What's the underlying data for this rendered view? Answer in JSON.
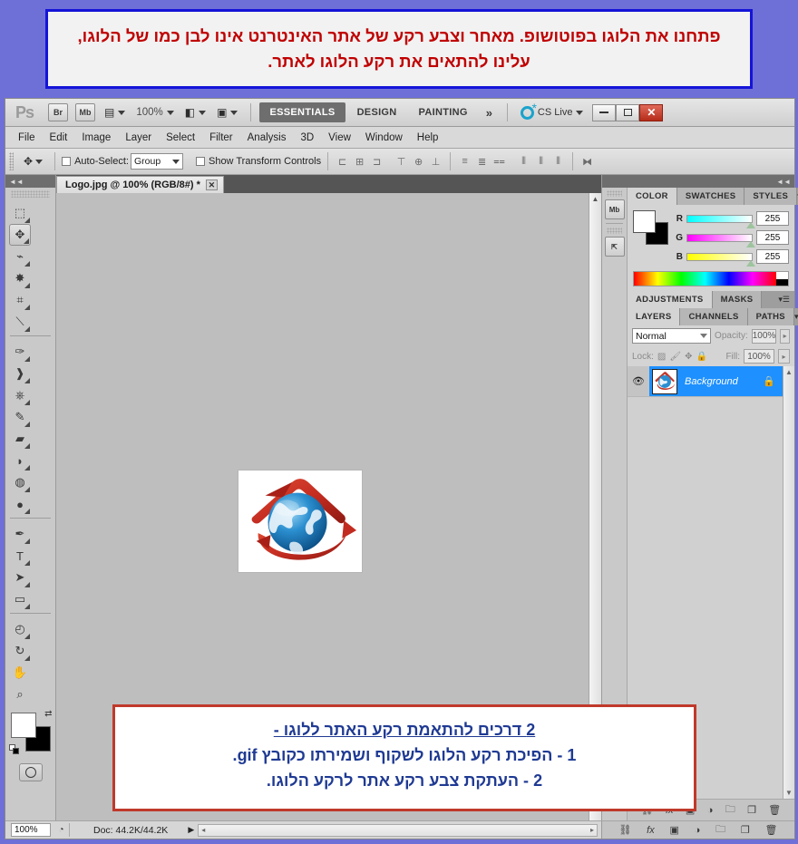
{
  "top_banner": {
    "text": "פתחנו את הלוגו בפוטושופ. מאחר וצבע רקע של אתר האינטרנט אינו לבן כמו של הלוגו, עלינו להתאים את רקע הלוגו לאתר.",
    "border_color": "#1414d8",
    "text_color": "#c00000"
  },
  "app": {
    "logo": "Ps",
    "bridge_button": "Br",
    "minibridge_button": "Mb",
    "view_extras_icon": "view-extras-icon",
    "zoom_level": "100%",
    "screen_mode_icon": "screen-mode-icon",
    "arrange_icon": "arrange-documents-icon",
    "workspaces": [
      {
        "label": "ESSENTIALS",
        "active": true
      },
      {
        "label": "DESIGN",
        "active": false
      },
      {
        "label": "PAINTING",
        "active": false
      }
    ],
    "more_workspaces": "»",
    "cs_live": "CS Live",
    "window_controls": {
      "minimize": "minimize-icon",
      "maximize": "maximize-icon",
      "close": "✕"
    }
  },
  "menu": {
    "items": [
      "File",
      "Edit",
      "Image",
      "Layer",
      "Select",
      "Filter",
      "Analysis",
      "3D",
      "View",
      "Window",
      "Help"
    ]
  },
  "options_bar": {
    "tool_icon": "move-tool-icon",
    "auto_select_label": "Auto-Select:",
    "auto_select_checked": false,
    "auto_select_value": "Group",
    "show_transform_label": "Show Transform Controls",
    "show_transform_checked": false,
    "align_left_edges": "align-left-edges-icon",
    "align_horizontal_centers": "align-horizontal-centers-icon",
    "align_right_edges": "align-right-edges-icon",
    "align_top_edges": "align-top-edges-icon",
    "align_vertical_centers": "align-vertical-centers-icon",
    "align_bottom_edges": "align-bottom-edges-icon",
    "distribute_top": "distribute-top-edges-icon",
    "distribute_vcenter": "distribute-vertical-centers-icon",
    "distribute_bottom": "distribute-bottom-edges-icon",
    "distribute_left": "distribute-left-edges-icon",
    "distribute_hcenter": "distribute-horizontal-centers-icon",
    "distribute_right": "distribute-right-edges-icon",
    "auto_align_layers": "auto-align-layers-icon"
  },
  "toolbox": {
    "collapse": "◄◄",
    "tools": [
      {
        "name": "rectangular-marquee-tool",
        "glyph": "⬚",
        "selected": false
      },
      {
        "name": "move-tool",
        "glyph": "✥",
        "selected": true
      },
      {
        "name": "lasso-tool",
        "glyph": "🪢",
        "selected": false
      },
      {
        "name": "quick-selection-tool",
        "glyph": "✷",
        "selected": false
      },
      {
        "name": "crop-tool",
        "glyph": "⌗",
        "selected": false
      },
      {
        "name": "eyedropper-tool",
        "glyph": "⟋",
        "selected": false
      },
      {
        "name": "spot-healing-brush-tool",
        "glyph": "✎",
        "selected": false
      },
      {
        "name": "brush-tool",
        "glyph": "🖌",
        "selected": false
      },
      {
        "name": "clone-stamp-tool",
        "glyph": "⎙",
        "selected": false
      },
      {
        "name": "history-brush-tool",
        "glyph": "✐",
        "selected": false
      },
      {
        "name": "eraser-tool",
        "glyph": "▰",
        "selected": false
      },
      {
        "name": "paint-bucket-tool",
        "glyph": "🪣",
        "selected": false
      },
      {
        "name": "blur-tool",
        "glyph": "💧",
        "selected": false
      },
      {
        "name": "dodge-tool",
        "glyph": "🔍",
        "selected": false
      },
      {
        "name": "pen-tool",
        "glyph": "✒",
        "selected": false
      },
      {
        "name": "type-tool",
        "glyph": "T",
        "selected": false
      },
      {
        "name": "path-selection-tool",
        "glyph": "➤",
        "selected": false
      },
      {
        "name": "rectangle-tool",
        "glyph": "▭",
        "selected": false
      },
      {
        "name": "3d-rotate-tool",
        "glyph": "◕",
        "selected": false
      },
      {
        "name": "3d-orbit-tool",
        "glyph": "↺",
        "selected": false
      },
      {
        "name": "hand-tool",
        "glyph": "✋",
        "selected": false
      },
      {
        "name": "zoom-tool",
        "glyph": "🔍",
        "selected": false
      }
    ],
    "foreground_color": "#ffffff",
    "background_color": "#000000",
    "swap_icon": "swap-colors-icon",
    "default_icon": "default-colors-icon",
    "quick_mask_icon": "quick-mask-icon"
  },
  "document": {
    "tab_title": "Logo.jpg @ 100% (RGB/8#) *",
    "close_icon": "✕",
    "canvas_bg": "#bebebe",
    "image_bg": "#ffffff"
  },
  "right_dock": {
    "collapse": "◄◄",
    "icon_buttons": [
      {
        "name": "mini-bridge-icon",
        "label": "Mb"
      },
      {
        "name": "history-icon",
        "label": "⇱"
      }
    ],
    "color_panel": {
      "tabs": [
        {
          "label": "COLOR",
          "active": true
        },
        {
          "label": "SWATCHES",
          "active": false
        },
        {
          "label": "STYLES",
          "active": false
        }
      ],
      "menu_icon": "panel-menu-icon",
      "foreground": "#ffffff",
      "background": "#000000",
      "channels": [
        {
          "label": "R",
          "value": "255"
        },
        {
          "label": "G",
          "value": "255"
        },
        {
          "label": "B",
          "value": "255"
        }
      ]
    },
    "adjustments_tabs": [
      {
        "label": "ADJUSTMENTS",
        "active": true
      },
      {
        "label": "MASKS",
        "active": false
      }
    ],
    "layers_panel": {
      "tabs": [
        {
          "label": "LAYERS",
          "active": true
        },
        {
          "label": "CHANNELS",
          "active": false
        },
        {
          "label": "PATHS",
          "active": false
        }
      ],
      "blend_mode": "Normal",
      "opacity_label": "Opacity:",
      "opacity_value": "100%",
      "lock_label": "Lock:",
      "lock_icons": [
        "lock-transparent-pixels-icon",
        "lock-image-pixels-icon",
        "lock-position-icon",
        "lock-all-icon"
      ],
      "fill_label": "Fill:",
      "fill_value": "100%",
      "layers": [
        {
          "name": "Background",
          "selected": true,
          "visible": true,
          "locked": true
        }
      ],
      "footer_icons": [
        "link-layers-icon",
        "add-layer-style-icon",
        "add-layer-mask-icon",
        "new-fill-adjustment-layer-icon",
        "new-group-icon",
        "new-layer-icon",
        "delete-layer-icon"
      ]
    }
  },
  "status_bar": {
    "zoom": "100%",
    "indicator_icon": "document-info-icon",
    "doc_size": "Doc: 44.2K/44.2K",
    "expand_icon": "▶"
  },
  "bottom_box": {
    "border_color": "#c0392b",
    "text_color": "#1f3a93",
    "heading": "2 דרכים להתאמת רקע האתר ללוגו -",
    "lines": [
      "1 - הפיכת רקע הלוגו לשקוף ושמירתו כקובץ gif.",
      "2 - העתקת צבע רקע אתר לרקע הלוגו."
    ]
  }
}
